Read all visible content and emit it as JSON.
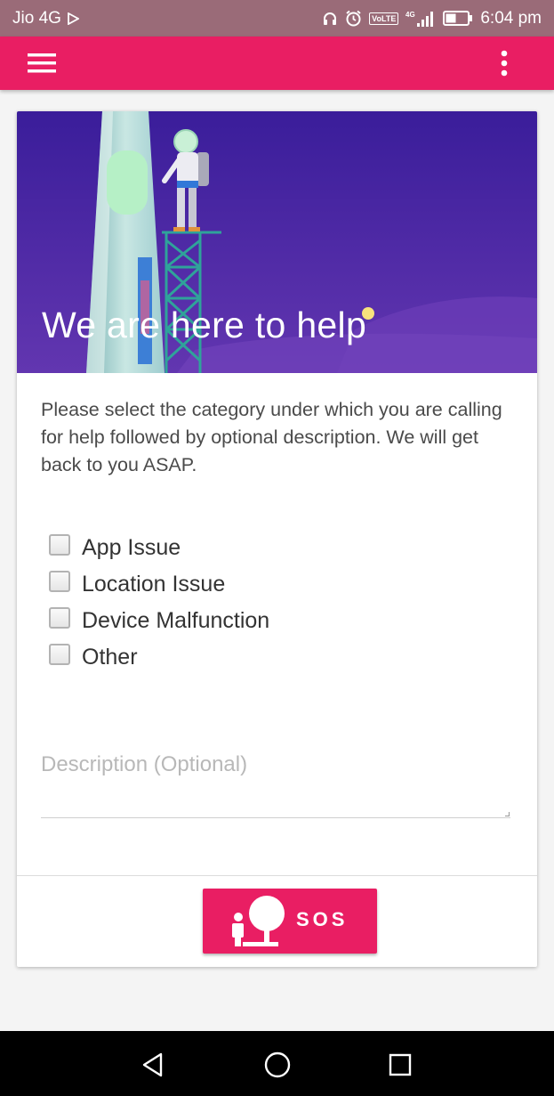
{
  "status_bar": {
    "carrier": "Jio 4G",
    "network_type": "4G",
    "volte": "VoLTE",
    "time": "6:04 pm",
    "icons": [
      "play-store-icon",
      "headphones-icon",
      "alarm-icon",
      "volte-icon",
      "signal-icon",
      "battery-icon"
    ]
  },
  "app_bar": {
    "color": "#e91e63",
    "icons": [
      "hamburger-menu-icon",
      "overflow-menu-icon"
    ]
  },
  "hero": {
    "title": "We are here to help",
    "colors": {
      "top": "#3a1d9a",
      "bottom": "#6236b0"
    }
  },
  "intro_text": "Please select the category under which you are calling for help followed by optional description. We will get back to you ASAP.",
  "categories": [
    {
      "label": "App Issue",
      "checked": false
    },
    {
      "label": "Location Issue",
      "checked": false
    },
    {
      "label": "Device Malfunction",
      "checked": false
    },
    {
      "label": "Other",
      "checked": false
    }
  ],
  "description": {
    "placeholder": "Description (Optional)",
    "value": ""
  },
  "sos_button": {
    "label": "SOS",
    "icon": "sos-person-icon"
  },
  "nav_bar": {
    "icons": [
      "back-icon",
      "home-icon",
      "recents-icon"
    ]
  }
}
